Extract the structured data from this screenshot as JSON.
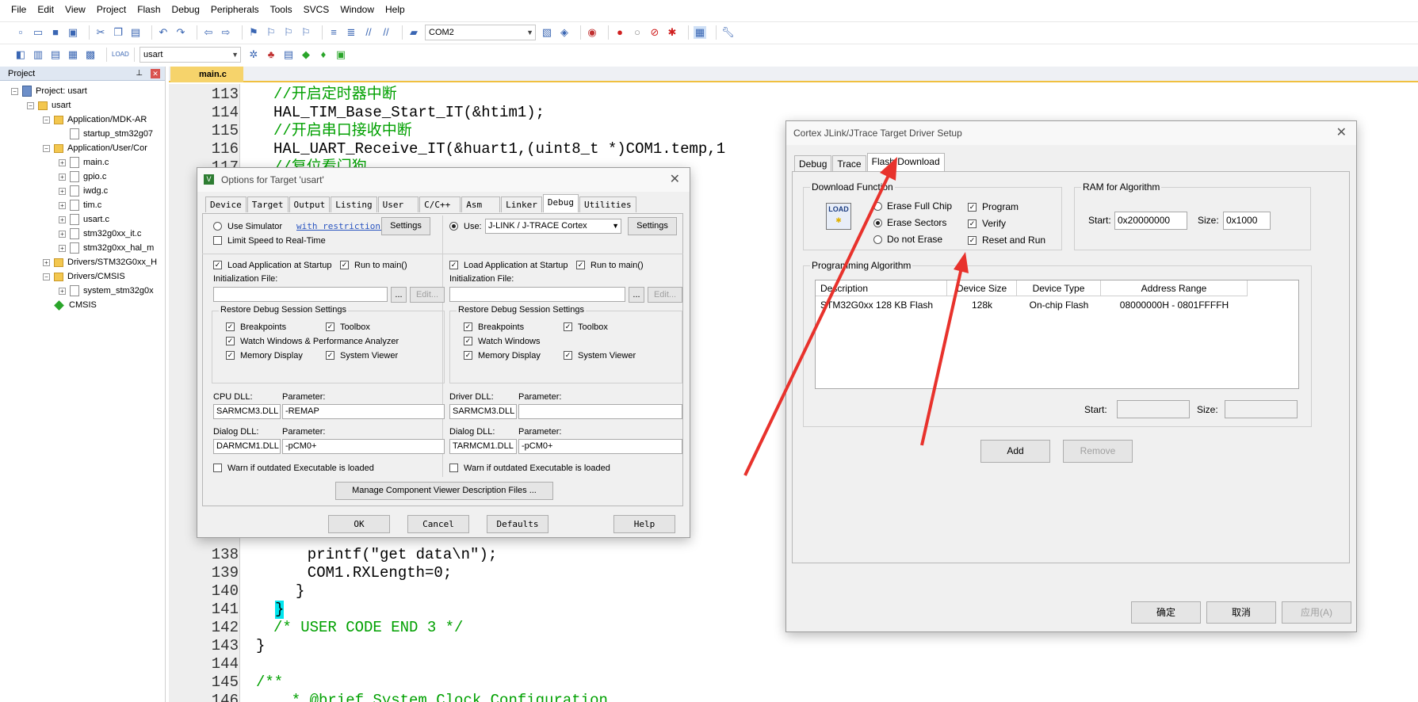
{
  "menu": [
    "File",
    "Edit",
    "View",
    "Project",
    "Flash",
    "Debug",
    "Peripherals",
    "Tools",
    "SVCS",
    "Window",
    "Help"
  ],
  "toolbar1": {
    "combo_value": "COM2"
  },
  "toolbar2": {
    "target_combo": "usart"
  },
  "project_panel": {
    "title": "Project",
    "tree": [
      {
        "label": "Project: usart"
      },
      {
        "label": "usart"
      },
      {
        "label": "Application/MDK-AR"
      },
      {
        "label": "startup_stm32g07"
      },
      {
        "label": "Application/User/Cor"
      },
      {
        "label": "main.c"
      },
      {
        "label": "gpio.c"
      },
      {
        "label": "iwdg.c"
      },
      {
        "label": "tim.c"
      },
      {
        "label": "usart.c"
      },
      {
        "label": "stm32g0xx_it.c"
      },
      {
        "label": "stm32g0xx_hal_m"
      },
      {
        "label": "Drivers/STM32G0xx_H"
      },
      {
        "label": "Drivers/CMSIS"
      },
      {
        "label": "system_stm32g0x"
      },
      {
        "label": "CMSIS"
      }
    ]
  },
  "editor": {
    "tab": "main.c",
    "lines": [
      {
        "n": "113",
        "t": "//开启定时器中断"
      },
      {
        "n": "114",
        "t": "HAL_TIM_Base_Start_IT(&htim1);"
      },
      {
        "n": "115",
        "t": "//开启串口接收中断"
      },
      {
        "n": "116",
        "t": "HAL_UART_Receive_IT(&huart1,(uint8_t *)COM1.temp,1"
      },
      {
        "n": "117",
        "t": "//复位看门狗"
      },
      {
        "n": "138",
        "t": "  printf(\"get data\\n\");"
      },
      {
        "n": "139",
        "t": "  COM1.RXLength=0;"
      },
      {
        "n": "140",
        "t": "}"
      },
      {
        "n": "141",
        "t": "}"
      },
      {
        "n": "142",
        "t": "/* USER CODE END 3 */"
      },
      {
        "n": "143",
        "t": "}"
      },
      {
        "n": "144",
        "t": ""
      },
      {
        "n": "145",
        "t": "/**"
      },
      {
        "n": "146",
        "t": "  * @brief System Clock Configuration"
      }
    ]
  },
  "options_dialog": {
    "title": "Options for Target 'usart'",
    "tabs": [
      "Device",
      "Target",
      "Output",
      "Listing",
      "User",
      "C/C++",
      "Asm",
      "Linker",
      "Debug",
      "Utilities"
    ],
    "left": {
      "use_simulator": "Use Simulator",
      "with_restrictions": "with restrictions",
      "settings": "Settings",
      "limit_speed": "Limit Speed to Real-Time",
      "load_app": "Load Application at Startup",
      "run_to_main": "Run to main()",
      "init_file": "Initialization File:",
      "browse": "...",
      "edit": "Edit...",
      "restore_title": "Restore Debug Session Settings",
      "breakpoints": "Breakpoints",
      "toolbox": "Toolbox",
      "watch": "Watch Windows & Performance Analyzer",
      "memory": "Memory Display",
      "system_viewer": "System Viewer",
      "cpu_dll_label": "CPU DLL:",
      "param_label": "Parameter:",
      "cpu_dll": "SARMCM3.DLL",
      "cpu_param": "-REMAP",
      "dialog_dll_label": "Dialog DLL:",
      "dialog_dll": "DARMCM1.DLL",
      "dialog_param": "-pCM0+",
      "warn": "Warn if outdated Executable is loaded"
    },
    "right": {
      "use": "Use:",
      "driver": "J-LINK / J-TRACE Cortex",
      "settings": "Settings",
      "load_app": "Load Application at Startup",
      "run_to_main": "Run to main()",
      "init_file": "Initialization File:",
      "browse": "...",
      "edit": "Edit...",
      "restore_title": "Restore Debug Session Settings",
      "breakpoints": "Breakpoints",
      "toolbox": "Toolbox",
      "watch": "Watch Windows",
      "memory": "Memory Display",
      "system_viewer": "System Viewer",
      "driver_dll_label": "Driver DLL:",
      "param_label": "Parameter:",
      "driver_dll": "SARMCM3.DLL",
      "driver_param": "",
      "dialog_dll_label": "Dialog DLL:",
      "dialog_dll": "TARMCM1.DLL",
      "dialog_param": "-pCM0+",
      "warn": "Warn if outdated Executable is loaded"
    },
    "manage_button": "Manage Component Viewer Description Files ...",
    "buttons": {
      "ok": "OK",
      "cancel": "Cancel",
      "defaults": "Defaults",
      "help": "Help"
    }
  },
  "jlink_dialog": {
    "title": "Cortex JLink/JTrace Target Driver Setup",
    "tabs": [
      "Debug",
      "Trace",
      "Flash Download"
    ],
    "download_function": {
      "title": "Download Function",
      "icon_text": "LOAD",
      "erase_full": "Erase Full Chip",
      "erase_sectors": "Erase Sectors",
      "do_not_erase": "Do not Erase",
      "program": "Program",
      "verify": "Verify",
      "reset_run": "Reset and Run"
    },
    "ram": {
      "title": "RAM for Algorithm",
      "start_label": "Start:",
      "start": "0x20000000",
      "size_label": "Size:",
      "size": "0x1000"
    },
    "programming": {
      "title": "Programming Algorithm",
      "columns": [
        "Description",
        "Device Size",
        "Device Type",
        "Address Range"
      ],
      "rows": [
        [
          "STM32G0xx 128 KB Flash",
          "128k",
          "On-chip Flash",
          "08000000H - 0801FFFFH"
        ]
      ],
      "start_label": "Start:",
      "size_label": "Size:"
    },
    "add": "Add",
    "remove": "Remove",
    "buttons": {
      "ok": "确定",
      "cancel": "取消",
      "apply": "应用(A)"
    }
  },
  "colors": {
    "arrow": "#e8322c",
    "comment": "#00a000",
    "tab_active": "#f6d36b"
  }
}
